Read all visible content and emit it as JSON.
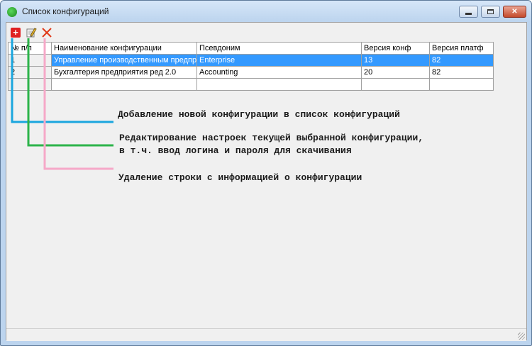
{
  "window": {
    "title": "Список конфигураций"
  },
  "toolbar": {
    "add_icon": "add-red-plus-icon",
    "edit_icon": "pencil-icon",
    "delete_icon": "red-x-icon"
  },
  "table": {
    "columns": [
      "№ п/п",
      "Наименование конфигурации",
      "Псевдоним",
      "Версия конф",
      "Версия платф"
    ],
    "rows": [
      {
        "num": "1",
        "name": "Управление производственным предприятием",
        "alias": "Enterprise",
        "conf_version": "13",
        "platform_version": "82"
      },
      {
        "num": "2",
        "name": "Бухгалтерия предприятия ред 2.0",
        "alias": "Accounting",
        "conf_version": "20",
        "platform_version": "82"
      }
    ]
  },
  "annotations": {
    "add": "Добавление новой конфигурации в список конфигураций",
    "edit": "Редактирование настроек текущей выбранной конфигурации, в т.ч. ввод логина и пароля для скачивания",
    "delete": "Удаление строки с информацией о конфигурации"
  },
  "colors": {
    "add_line": "#1aa6de",
    "edit_line": "#2db34a",
    "delete_line": "#f6a8c8",
    "selection": "#3399ff"
  }
}
